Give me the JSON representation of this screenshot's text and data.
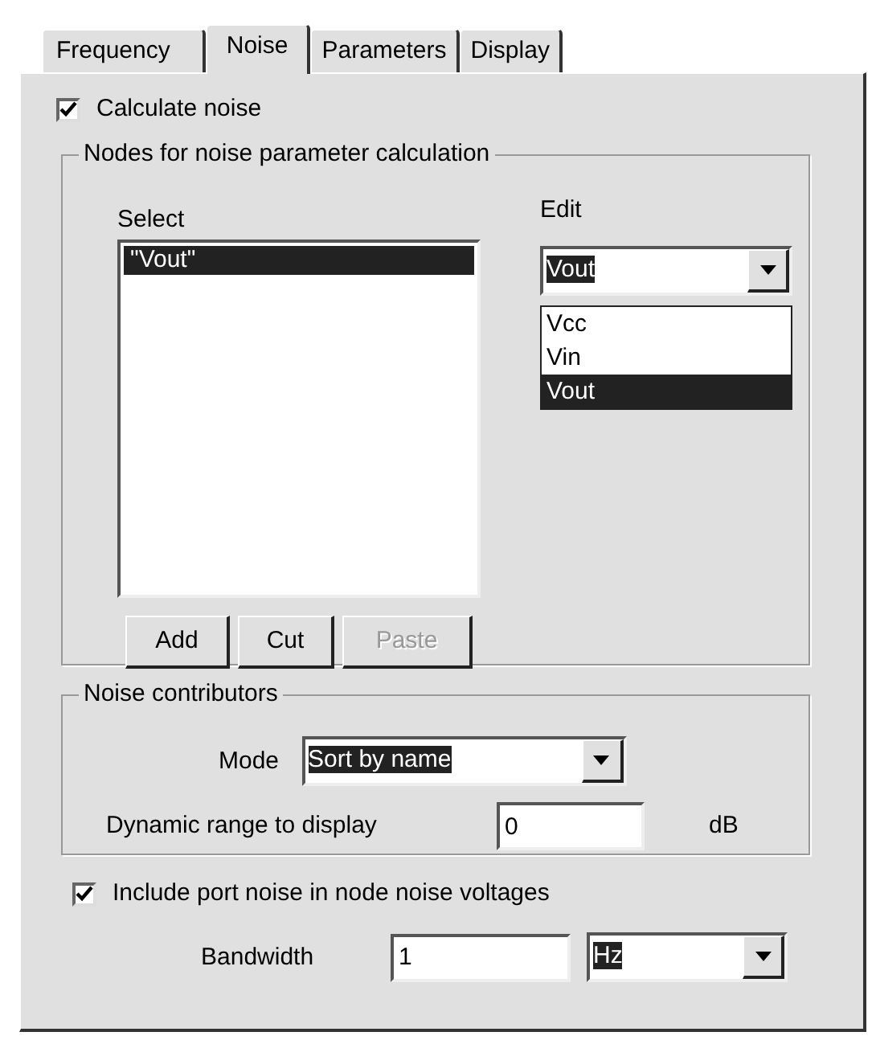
{
  "tabs": [
    {
      "label": "Frequency",
      "selected": false
    },
    {
      "label": "Noise",
      "selected": true
    },
    {
      "label": "Parameters",
      "selected": false
    },
    {
      "label": "Display",
      "selected": false
    }
  ],
  "calculate_noise": {
    "label": "Calculate noise",
    "checked": true
  },
  "nodes_group": {
    "title": "Nodes for noise parameter calculation",
    "select_label": "Select",
    "select_items": [
      {
        "label": "\"Vout\"",
        "selected": true
      }
    ],
    "buttons": [
      {
        "label": "Add",
        "disabled": false
      },
      {
        "label": "Cut",
        "disabled": false
      },
      {
        "label": "Paste",
        "disabled": true
      }
    ],
    "edit_label": "Edit",
    "edit_value": "Vout",
    "edit_options": [
      {
        "label": "Vcc",
        "selected": false
      },
      {
        "label": "Vin",
        "selected": false
      },
      {
        "label": "Vout",
        "selected": true
      }
    ]
  },
  "contributors_group": {
    "title": "Noise contributors",
    "mode_label": "Mode",
    "mode_value": "Sort by name",
    "range_label": "Dynamic range to display",
    "range_value": "0",
    "range_unit": "dB"
  },
  "include_port_noise": {
    "label": "Include port noise in node noise voltages",
    "checked": true
  },
  "bandwidth": {
    "label": "Bandwidth",
    "value": "1",
    "unit": "Hz"
  }
}
